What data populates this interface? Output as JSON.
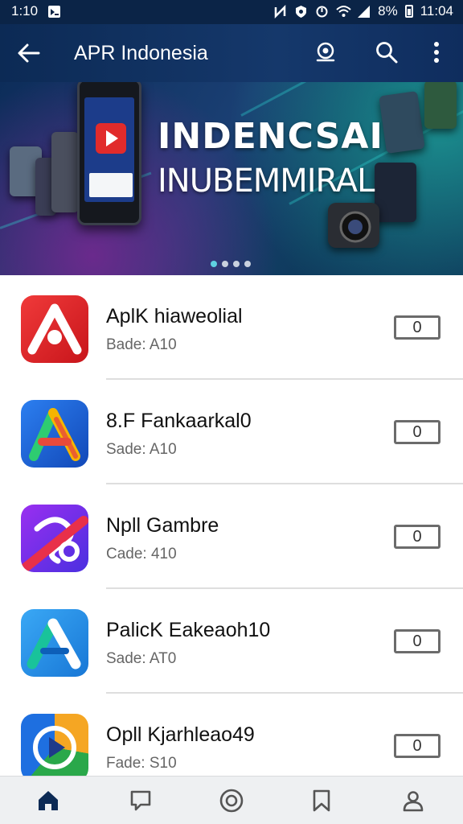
{
  "status_bar": {
    "time_left": "1:10",
    "battery": "8%",
    "time_right": "11:04"
  },
  "app_bar": {
    "title": "APR Indonesia"
  },
  "banner": {
    "headline": "INDENCSAI",
    "subline": "INUBEMMIRAL"
  },
  "apps": [
    {
      "name": "AplK hiaweolial",
      "meta": "Bade: A10",
      "count": "0",
      "icon": "red-a-icon",
      "color": "#e2252b"
    },
    {
      "name": "8.F Fankaarkal0",
      "meta": "Sade: A10",
      "count": "0",
      "icon": "multicolor-a-icon",
      "color": "#1f6fe0"
    },
    {
      "name": "Npll Gambre",
      "meta": "Cade: 410",
      "count": "0",
      "icon": "purple-swirl-icon",
      "color": "#7b2ff0"
    },
    {
      "name": "PalicK Eakeaoh10",
      "meta": "Sade: AT0",
      "count": "0",
      "icon": "teal-a-icon",
      "color": "#1e90e6"
    },
    {
      "name": "Opll Kjarhleao49",
      "meta": "Fade: S10",
      "count": "0",
      "icon": "play-circle-icon",
      "color": "#2aa84a"
    }
  ],
  "bottom_nav": [
    "home-icon",
    "chat-icon",
    "target-icon",
    "bookmark-icon",
    "profile-icon"
  ],
  "colors": {
    "primary": "#0c2a55",
    "accent": "#2fd4d0"
  }
}
